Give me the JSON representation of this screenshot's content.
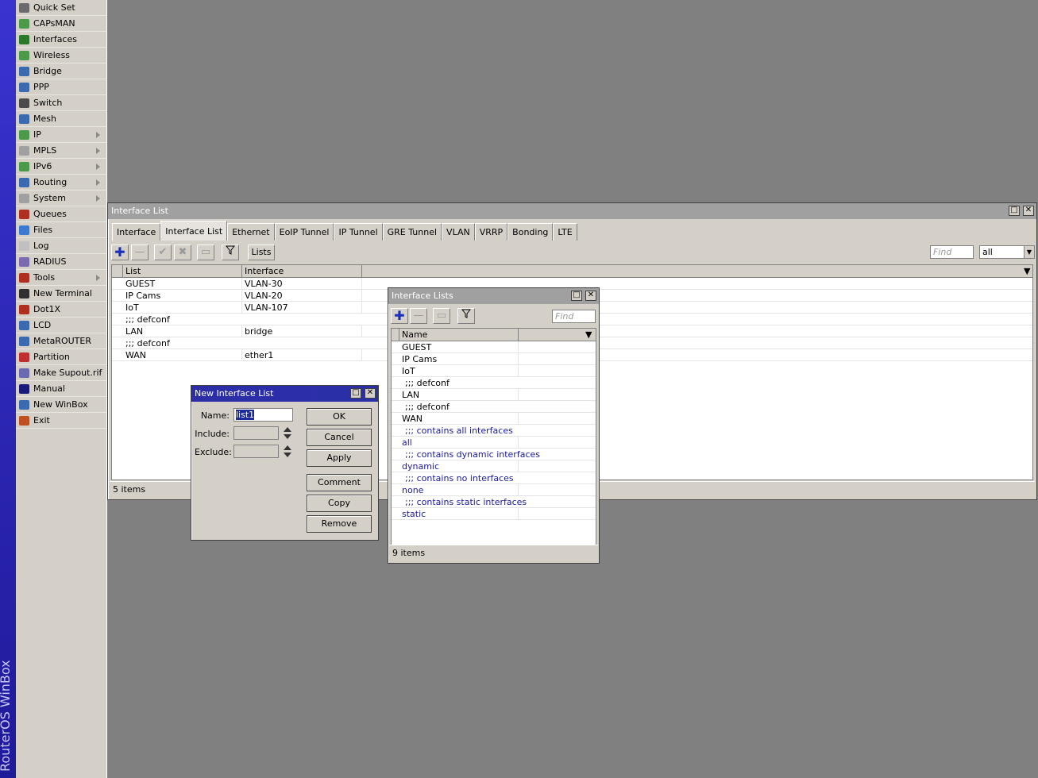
{
  "brand": {
    "text": "RouterOS WinBox"
  },
  "sidebar": {
    "items": [
      {
        "label": "Quick Set",
        "icon": "wand-icon",
        "color": "#6b6b6b",
        "sub": false
      },
      {
        "label": "CAPsMAN",
        "icon": "antenna-icon",
        "color": "#4a9a4a",
        "sub": false
      },
      {
        "label": "Interfaces",
        "icon": "interfaces-icon",
        "color": "#2b7a2b",
        "sub": false
      },
      {
        "label": "Wireless",
        "icon": "wireless-icon",
        "color": "#4a9a4a",
        "sub": false
      },
      {
        "label": "Bridge",
        "icon": "bridge-icon",
        "color": "#3a6ab0",
        "sub": false
      },
      {
        "label": "PPP",
        "icon": "ppp-icon",
        "color": "#3a6ab0",
        "sub": false
      },
      {
        "label": "Switch",
        "icon": "switch-icon",
        "color": "#4a4a4a",
        "sub": false
      },
      {
        "label": "Mesh",
        "icon": "mesh-icon",
        "color": "#3a6ab0",
        "sub": false
      },
      {
        "label": "IP",
        "icon": "ip-icon",
        "color": "#4a9a4a",
        "sub": true
      },
      {
        "label": "MPLS",
        "icon": "mpls-icon",
        "color": "#a0a0a0",
        "sub": true
      },
      {
        "label": "IPv6",
        "icon": "ipv6-icon",
        "color": "#4a9a4a",
        "sub": true
      },
      {
        "label": "Routing",
        "icon": "routing-icon",
        "color": "#3a6ab0",
        "sub": true
      },
      {
        "label": "System",
        "icon": "gear-icon",
        "color": "#a0a0a0",
        "sub": true
      },
      {
        "label": "Queues",
        "icon": "queues-icon",
        "color": "#b03020",
        "sub": false
      },
      {
        "label": "Files",
        "icon": "folder-icon",
        "color": "#3a7ad0",
        "sub": false
      },
      {
        "label": "Log",
        "icon": "log-icon",
        "color": "#c0c0c0",
        "sub": false
      },
      {
        "label": "RADIUS",
        "icon": "radius-icon",
        "color": "#7a6ab0",
        "sub": false
      },
      {
        "label": "Tools",
        "icon": "tools-icon",
        "color": "#b03020",
        "sub": true
      },
      {
        "label": "New Terminal",
        "icon": "terminal-icon",
        "color": "#303030",
        "sub": false
      },
      {
        "label": "Dot1X",
        "icon": "dot1x-icon",
        "color": "#b03020",
        "sub": false
      },
      {
        "label": "LCD",
        "icon": "lcd-icon",
        "color": "#3a6ab0",
        "sub": false
      },
      {
        "label": "MetaROUTER",
        "icon": "metarouter-icon",
        "color": "#3a6ab0",
        "sub": false
      },
      {
        "label": "Partition",
        "icon": "partition-icon",
        "color": "#c03030",
        "sub": false
      },
      {
        "label": "Make Supout.rif",
        "icon": "supout-icon",
        "color": "#6a6ab0",
        "sub": false
      },
      {
        "label": "Manual",
        "icon": "manual-icon",
        "color": "#1a1a7a",
        "sub": false
      },
      {
        "label": "New WinBox",
        "icon": "winbox-icon",
        "color": "#3a6ab0",
        "sub": false
      },
      {
        "label": "Exit",
        "icon": "exit-icon",
        "color": "#c05020",
        "sub": false
      }
    ]
  },
  "main_window": {
    "title": "Interface List",
    "tabs": [
      "Interface",
      "Interface List",
      "Ethernet",
      "EoIP Tunnel",
      "IP Tunnel",
      "GRE Tunnel",
      "VLAN",
      "VRRP",
      "Bonding",
      "LTE"
    ],
    "selected_tab": "Interface List",
    "toolbar": {
      "lists_label": "Lists"
    },
    "find_placeholder": "Find",
    "filter_value": "all",
    "columns": [
      "List",
      "Interface"
    ],
    "rows": [
      {
        "list": "GUEST",
        "interface": "VLAN-30"
      },
      {
        "list": "IP Cams",
        "interface": "VLAN-20"
      },
      {
        "list": "IoT",
        "interface": "VLAN-107"
      },
      {
        "comment": ";;; defconf"
      },
      {
        "list": "LAN",
        "interface": "bridge"
      },
      {
        "comment": ";;; defconf"
      },
      {
        "list": "WAN",
        "interface": "ether1"
      }
    ],
    "status": "5 items"
  },
  "lists_window": {
    "title": "Interface Lists",
    "find_placeholder": "Find",
    "columns": [
      "Name"
    ],
    "rows": [
      {
        "name": "GUEST",
        "dynamic": false
      },
      {
        "name": "IP Cams",
        "dynamic": false
      },
      {
        "name": "IoT",
        "dynamic": false
      },
      {
        "comment": ";;; defconf",
        "dynamic": false
      },
      {
        "name": "LAN",
        "dynamic": false
      },
      {
        "comment": ";;; defconf",
        "dynamic": false
      },
      {
        "name": "WAN",
        "dynamic": false
      },
      {
        "comment": ";;; contains all interfaces",
        "dynamic": true
      },
      {
        "name": "all",
        "dynamic": true
      },
      {
        "comment": ";;; contains dynamic interfaces",
        "dynamic": true
      },
      {
        "name": "dynamic",
        "dynamic": true
      },
      {
        "comment": ";;; contains no interfaces",
        "dynamic": true
      },
      {
        "name": "none",
        "dynamic": true
      },
      {
        "comment": ";;; contains static interfaces",
        "dynamic": true
      },
      {
        "name": "static",
        "dynamic": true
      }
    ],
    "status": "9 items"
  },
  "new_dialog": {
    "title": "New Interface List",
    "name_label": "Name:",
    "name_value": "list1",
    "include_label": "Include:",
    "exclude_label": "Exclude:",
    "buttons": {
      "ok": "OK",
      "cancel": "Cancel",
      "apply": "Apply",
      "comment": "Comment",
      "copy": "Copy",
      "remove": "Remove"
    }
  }
}
